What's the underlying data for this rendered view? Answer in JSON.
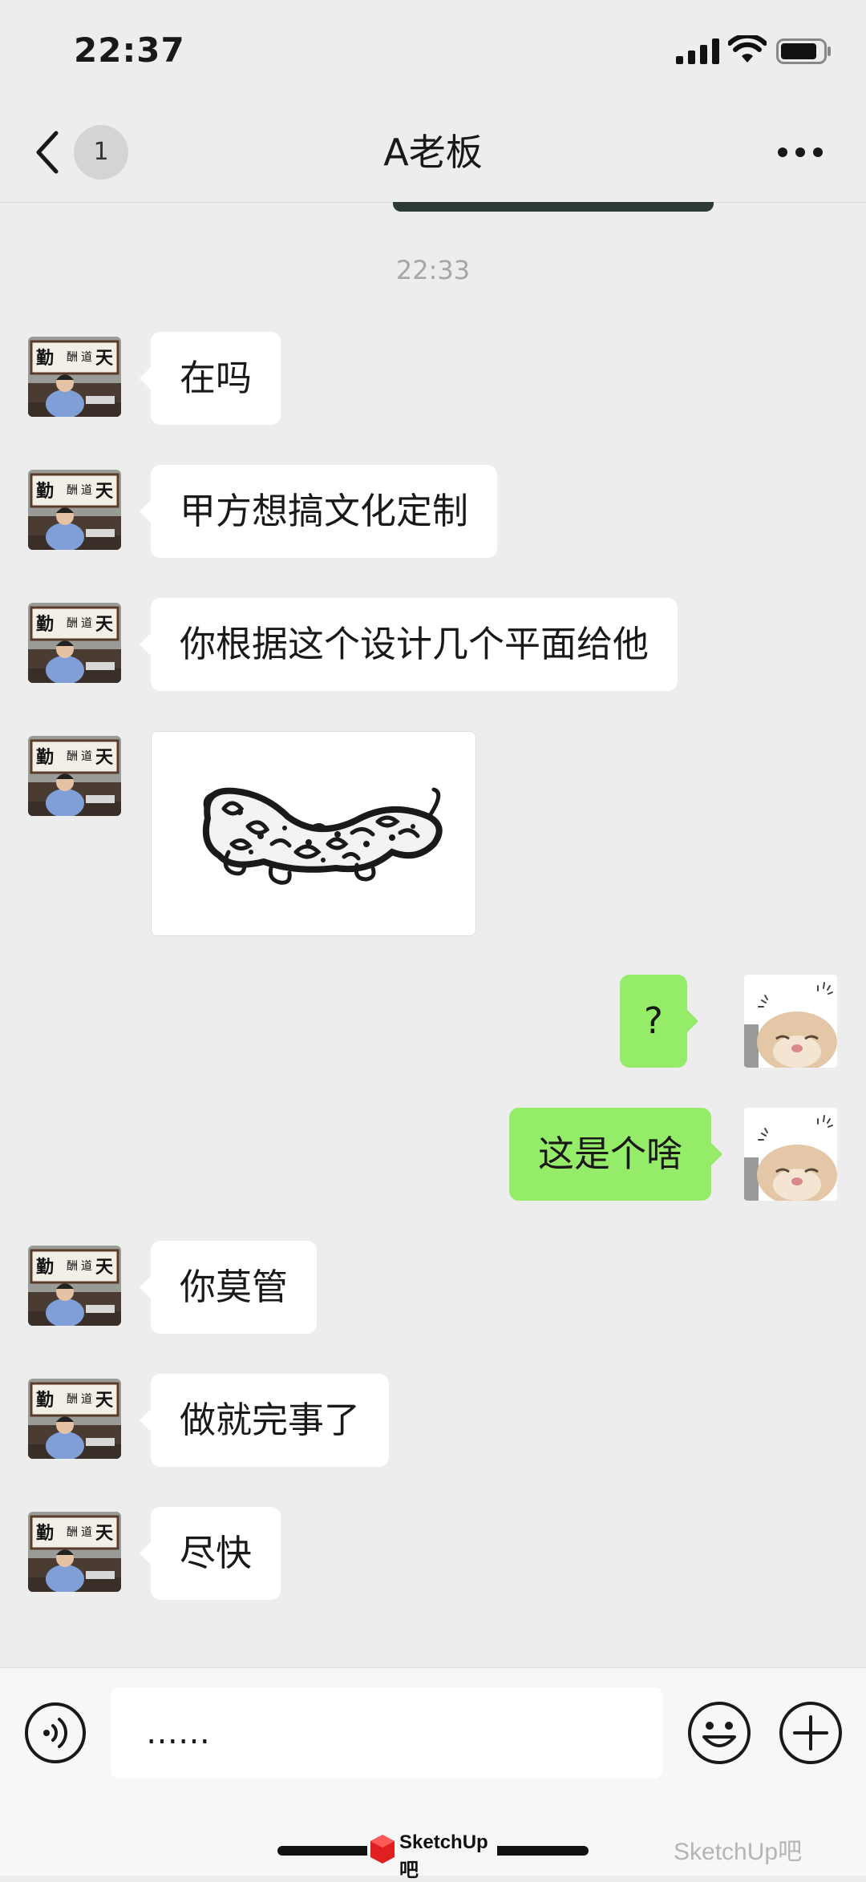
{
  "status_bar": {
    "time": "22:37"
  },
  "nav": {
    "back_badge": "1",
    "title": "A老板"
  },
  "timestamp": "22:33",
  "messages": [
    {
      "side": "in",
      "text": "在吗"
    },
    {
      "side": "in",
      "text": "甲方想搞文化定制"
    },
    {
      "side": "in",
      "text": "你根据这个设计几个平面给他"
    },
    {
      "side": "in",
      "type": "image",
      "description_icon": "dragon-pattern-image"
    },
    {
      "side": "out",
      "text": "?"
    },
    {
      "side": "out",
      "text": "这是个啥"
    },
    {
      "side": "in",
      "text": "你莫管"
    },
    {
      "side": "in",
      "text": "做就完事了"
    },
    {
      "side": "in",
      "text": "尽快"
    }
  ],
  "input": {
    "value": "……"
  },
  "watermark": {
    "logo_text": "SketchUp吧",
    "account": "SketchUp吧"
  },
  "colors": {
    "background": "#ededed",
    "incoming": "#ffffff",
    "outgoing": "#95ec69"
  }
}
